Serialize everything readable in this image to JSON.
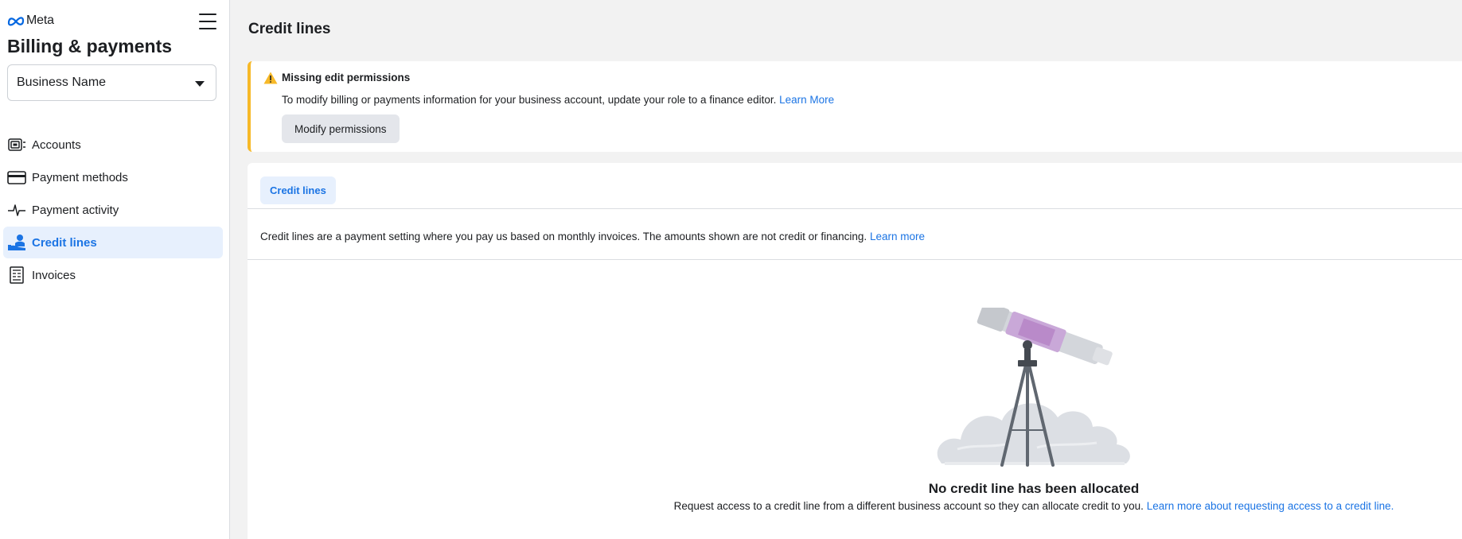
{
  "sidebar": {
    "logo_text": "Meta",
    "title": "Billing & payments",
    "business_select": {
      "value": "Business Name"
    },
    "items": [
      {
        "label": "Accounts",
        "icon": "accounts-icon",
        "active": false
      },
      {
        "label": "Payment methods",
        "icon": "card-icon",
        "active": false
      },
      {
        "label": "Payment activity",
        "icon": "activity-icon",
        "active": false
      },
      {
        "label": "Credit lines",
        "icon": "credit-lines-icon",
        "active": true
      },
      {
        "label": "Invoices",
        "icon": "invoice-icon",
        "active": false
      }
    ]
  },
  "main": {
    "title": "Credit lines",
    "banner": {
      "heading": "Missing edit permissions",
      "message": "To modify billing or payments information for your business account, update your role to a finance editor.",
      "link": "Learn More",
      "button": "Modify permissions"
    },
    "card": {
      "tab": "Credit lines",
      "info": "Credit lines are a payment setting where you pay us based on monthly invoices. The amounts shown are not credit or financing.",
      "info_link": "Learn more",
      "empty_title": "No credit line has been allocated",
      "empty_text": "Request access to a credit line from a different business account so they can allocate credit to you.",
      "empty_link": "Learn more about requesting access to a credit line."
    }
  },
  "colors": {
    "accent": "#1b74e4",
    "active_bg": "#e7f0fd",
    "warning": "#f7b928",
    "page_bg": "#f2f2f2"
  }
}
